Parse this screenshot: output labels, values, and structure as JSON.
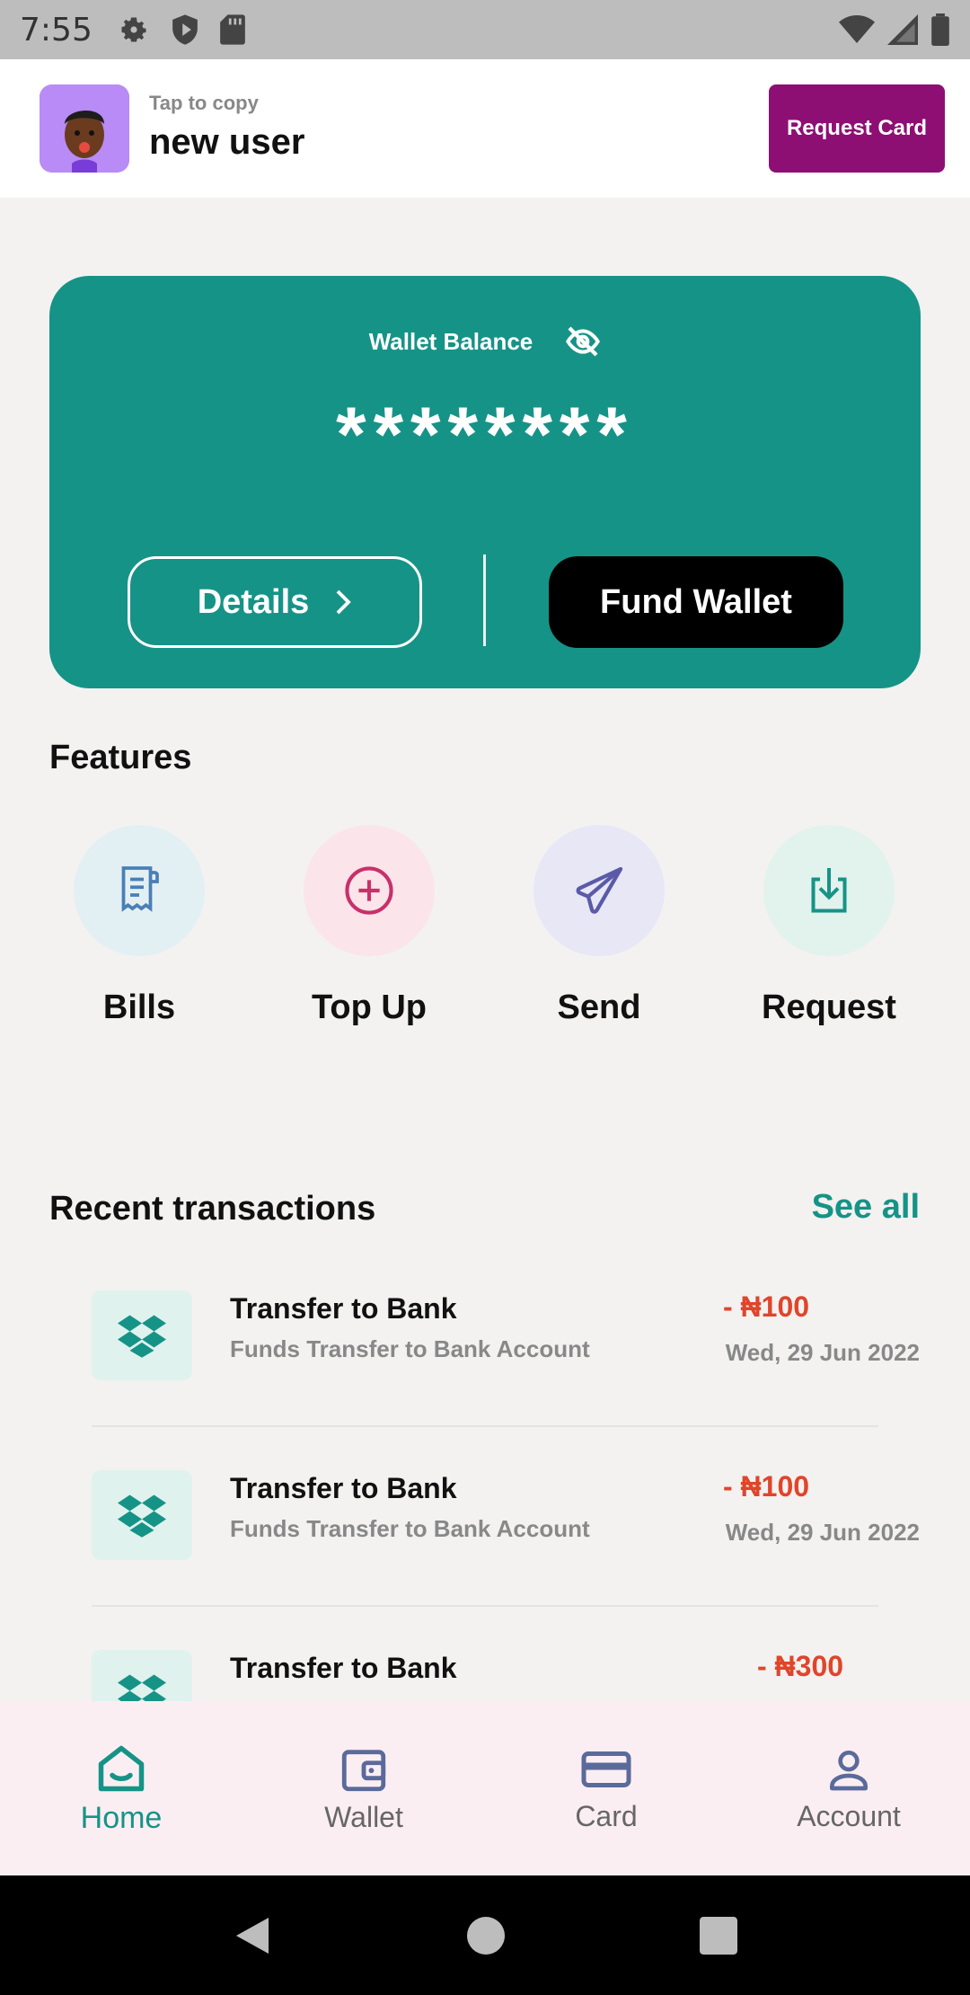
{
  "status_bar": {
    "time": "7:55",
    "left_icons": [
      "gear-icon",
      "shield-icon",
      "sd-card-icon"
    ],
    "right_icons": [
      "wifi-icon",
      "signal-icon",
      "battery-icon"
    ]
  },
  "header": {
    "tap_to_copy": "Tap to copy",
    "user_name": "new user",
    "request_card_label": "Request Card",
    "accent_color": "#8e0f74"
  },
  "wallet": {
    "label": "Wallet Balance",
    "masked_amount": "********",
    "details_label": "Details",
    "fund_label": "Fund Wallet",
    "card_color": "#169387"
  },
  "features": {
    "title": "Features",
    "items": [
      {
        "label": "Bills",
        "icon": "receipt-icon",
        "bg": "#e3f0f3"
      },
      {
        "label": "Top Up",
        "icon": "plus-circle-icon",
        "bg": "#fbe4ea"
      },
      {
        "label": "Send",
        "icon": "send-icon",
        "bg": "#e7e7f6"
      },
      {
        "label": "Request",
        "icon": "download-icon",
        "bg": "#e2f2ec"
      }
    ]
  },
  "transactions": {
    "title": "Recent transactions",
    "see_all": "See all",
    "items": [
      {
        "title": "Transfer to Bank",
        "subtitle": "Funds Transfer to Bank Account",
        "amount": "- ₦100",
        "date": "Wed, 29 Jun 2022"
      },
      {
        "title": "Transfer to Bank",
        "subtitle": "Funds Transfer to Bank Account",
        "amount": "- ₦100",
        "date": "Wed, 29 Jun 2022"
      },
      {
        "title": "Transfer to Bank",
        "subtitle": "",
        "amount": "- ₦300",
        "date": ""
      }
    ]
  },
  "bottom_nav": {
    "items": [
      {
        "label": "Home",
        "icon": "home-icon",
        "active": true
      },
      {
        "label": "Wallet",
        "icon": "wallet-icon",
        "active": false
      },
      {
        "label": "Card",
        "icon": "card-icon",
        "active": false
      },
      {
        "label": "Account",
        "icon": "account-icon",
        "active": false
      }
    ],
    "active_color": "#169387"
  }
}
